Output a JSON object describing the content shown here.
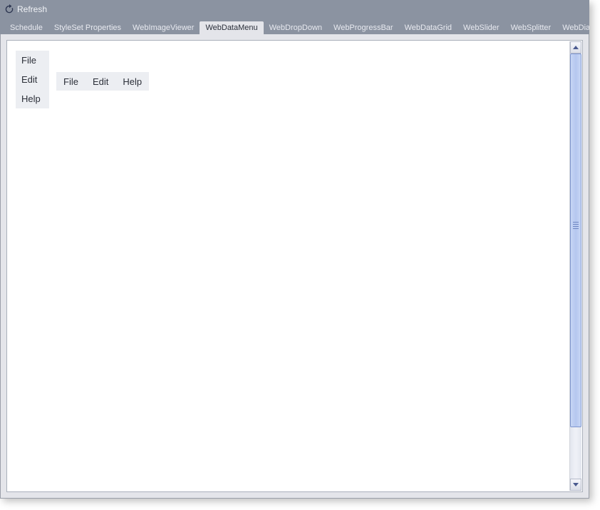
{
  "window": {
    "title": "Refresh"
  },
  "tabs": [
    {
      "label": "Schedule",
      "active": false
    },
    {
      "label": "StyleSet Properties",
      "active": false
    },
    {
      "label": "WebImageViewer",
      "active": false
    },
    {
      "label": "WebDataMenu",
      "active": true
    },
    {
      "label": "WebDropDown",
      "active": false
    },
    {
      "label": "WebProgressBar",
      "active": false
    },
    {
      "label": "WebDataGrid",
      "active": false
    },
    {
      "label": "WebSlider",
      "active": false
    },
    {
      "label": "WebSplitter",
      "active": false
    },
    {
      "label": "WebDialogW",
      "active": false
    }
  ],
  "vertical_menu": {
    "items": [
      "File",
      "Edit",
      "Help"
    ]
  },
  "horizontal_menu": {
    "items": [
      "File",
      "Edit",
      "Help"
    ]
  },
  "icons": {
    "refresh": "refresh-icon"
  }
}
